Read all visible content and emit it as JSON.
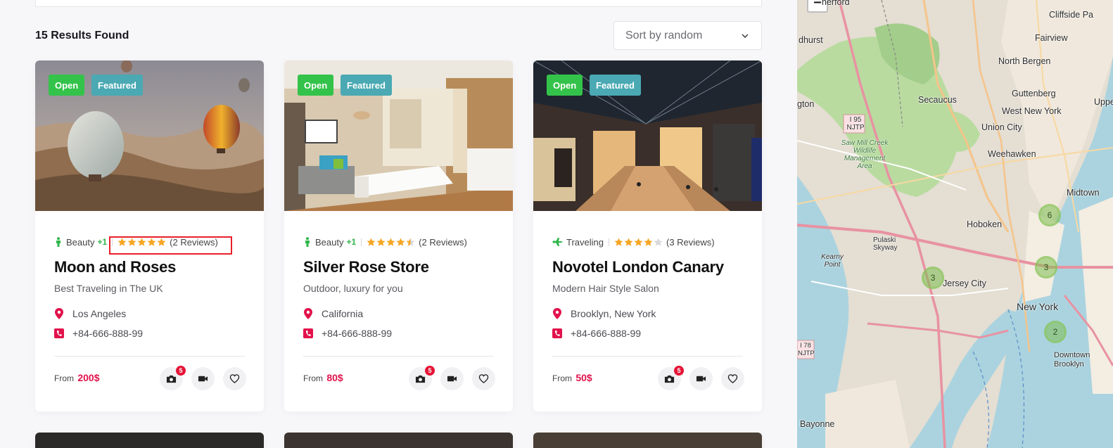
{
  "results": {
    "label": "15 Results Found"
  },
  "sort": {
    "value": "Sort by random"
  },
  "cards": [
    {
      "status": "Open",
      "featured": "Featured",
      "category": "Beauty",
      "category_extra": "+1",
      "rating": 5,
      "reviews": "(2 Reviews)",
      "title": "Moon and Roses",
      "description": "Best Traveling in The UK",
      "location": "Los Angeles",
      "phone": "+84-666-888-99",
      "price_prefix": "From",
      "price": "200$",
      "photo_count": "5"
    },
    {
      "status": "Open",
      "featured": "Featured",
      "category": "Beauty",
      "category_extra": "+1",
      "rating": 4.5,
      "reviews": "(2 Reviews)",
      "title": "Silver Rose Store",
      "description": "Outdoor, luxury for you",
      "location": "California",
      "phone": "+84-666-888-99",
      "price_prefix": "From",
      "price": "80$",
      "photo_count": "5"
    },
    {
      "status": "Open",
      "featured": "Featured",
      "category": "Traveling",
      "category_extra": "",
      "rating": 4,
      "reviews": "(3 Reviews)",
      "title": "Novotel London Canary",
      "description": "Modern Hair Style Salon",
      "location": "Brooklyn, New York",
      "phone": "+84-666-888-99",
      "price_prefix": "From",
      "price": "50$",
      "photo_count": "5"
    }
  ],
  "map": {
    "zoom_out": "−",
    "labels": [
      "herford",
      "Cliffside Pa",
      "Fairview",
      "dhurst",
      "North Bergen",
      "Guttenberg",
      "Secaucus",
      "West New York",
      "gton",
      "Union City",
      "Upper",
      "Weehawken",
      "Midtown",
      "Hoboken",
      "Jersey City",
      "New York",
      "Downtown Brooklyn",
      "Bayonne",
      "I 95 NJTP",
      "Saw Mill Creek Wildlife Management Area",
      "Pulaski Skyway",
      "Kearny Point",
      "I 78 NJTP"
    ],
    "clusters": [
      "6",
      "3",
      "3",
      "2"
    ]
  },
  "colors": {
    "open": "#34c34a",
    "featured": "#4aa9b3",
    "price": "#e2124b",
    "star": "#f5a623",
    "accent_red": "#e51436"
  }
}
